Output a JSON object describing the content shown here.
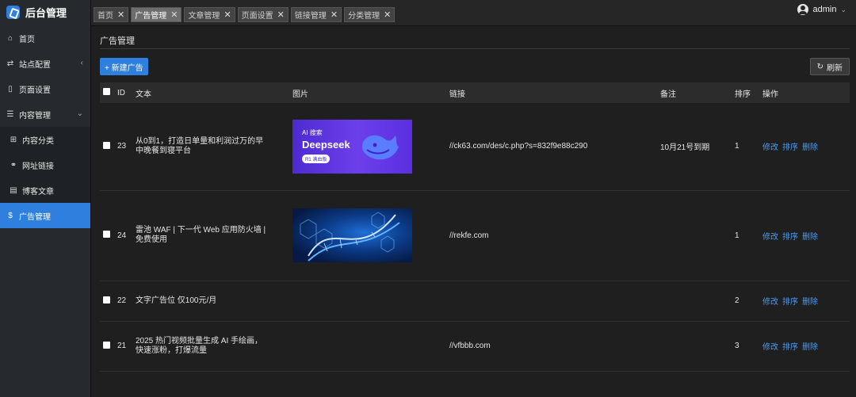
{
  "app": {
    "title": "后台管理"
  },
  "sidebar": {
    "items": [
      {
        "label": "首页",
        "icon": "home-icon"
      },
      {
        "label": "站点配置",
        "icon": "swap-icon",
        "caret": "‹"
      },
      {
        "label": "页面设置",
        "icon": "file-icon"
      },
      {
        "label": "内容管理",
        "icon": "list-icon",
        "caret": "⌄"
      },
      {
        "label": "内容分类",
        "icon": "grid-icon"
      },
      {
        "label": "网址链接",
        "icon": "link-icon"
      },
      {
        "label": "博客文章",
        "icon": "document-icon"
      },
      {
        "label": "广告管理",
        "icon": "dollar-icon"
      }
    ]
  },
  "tabs": [
    {
      "label": "首页"
    },
    {
      "label": "广告管理"
    },
    {
      "label": "文章管理"
    },
    {
      "label": "页面设置"
    },
    {
      "label": "链接管理"
    },
    {
      "label": "分类管理"
    }
  ],
  "user": {
    "name": "admin"
  },
  "main": {
    "title": "广告管理",
    "new_button": "+ 新建广告",
    "refresh_button": "刷新"
  },
  "table": {
    "headers": [
      "ID",
      "文本",
      "图片",
      "链接",
      "备注",
      "排序",
      "操作"
    ],
    "ops": [
      "修改",
      "排序",
      "删除"
    ],
    "rows": [
      {
        "id": "23",
        "text": "从0到1，打造日单量和利润过万的早中晚餐到寝平台",
        "link": "//ck63.com/des/c.php?s=832f9e88c290",
        "note": "10月21号到期",
        "order": "1"
      },
      {
        "id": "24",
        "text": "雷池 WAF | 下一代 Web 应用防火墙 | 免费使用",
        "link": "//rekfe.com",
        "note": "",
        "order": "1"
      },
      {
        "id": "22",
        "text": "文字广告位 仅100元/月",
        "link": "",
        "note": "",
        "order": "2"
      },
      {
        "id": "21",
        "text": "2025 热门视频批量生成 AI 手绘画，快速涨粉，打爆流量",
        "link": "//vfbbb.com",
        "note": "",
        "order": "3"
      }
    ]
  },
  "ad_image_1": {
    "line1": "AI 搜索",
    "line2": "Deepseek",
    "badge": "R1 满血版"
  },
  "colors": {
    "accent": "#2f7fde",
    "link": "#4c9bf0"
  }
}
